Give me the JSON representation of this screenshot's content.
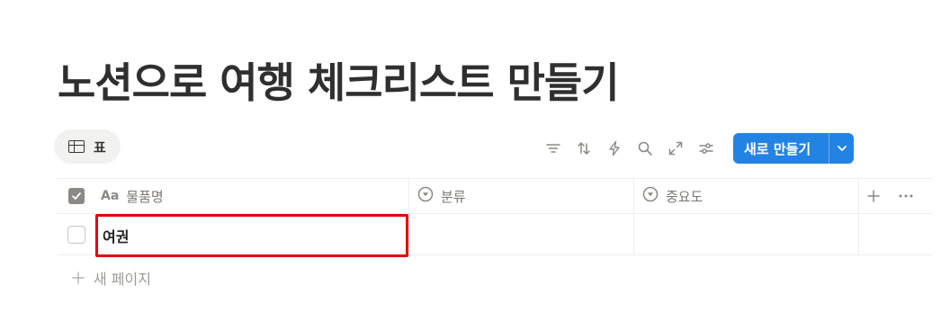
{
  "page": {
    "title": "노션으로 여행 체크리스트 만들기"
  },
  "view": {
    "tab_label": "표",
    "tab_icon": "table-icon"
  },
  "toolbar": {
    "icons": [
      "filter-icon",
      "sort-icon",
      "automation-icon",
      "search-icon",
      "expand-icon",
      "settings-icon"
    ],
    "new_button_label": "새로 만들기",
    "accent_color": "#2383e2"
  },
  "table": {
    "columns": [
      {
        "label": "물품명",
        "icon": "text-type-icon",
        "icon_text": "Aa"
      },
      {
        "label": "분류",
        "icon": "select-icon"
      },
      {
        "label": "중요도",
        "icon": "select-icon"
      }
    ],
    "rows": [
      {
        "name": "여권",
        "category": "",
        "importance": ""
      }
    ],
    "add_column_icon": "plus-icon",
    "more_icon": "more-icon",
    "new_page_label": "새 페이지"
  },
  "highlight_color": "#e60000"
}
